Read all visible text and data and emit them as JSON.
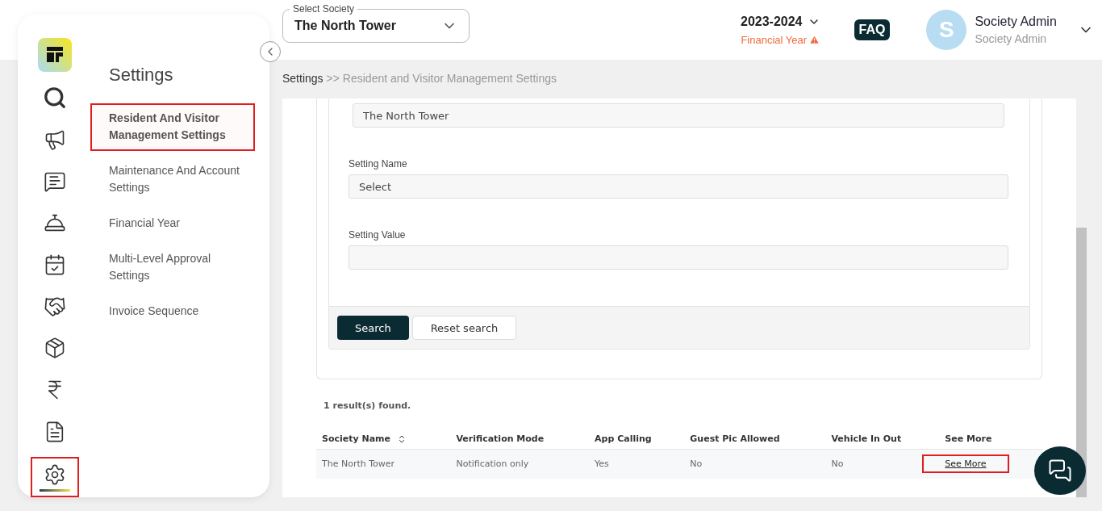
{
  "header": {
    "society_select": {
      "label": "Select Society",
      "value": "The North Tower"
    },
    "financial_year": {
      "value": "2023-2024",
      "label": "Financial Year",
      "warning": true
    },
    "faq": "FAQ",
    "user": {
      "initial": "S",
      "name": "Society Admin",
      "role": "Society Admin"
    }
  },
  "rail": [
    {
      "kind": "logo",
      "selected": false,
      "highlighted": false
    },
    {
      "kind": "search",
      "selected": false,
      "highlighted": false
    },
    {
      "kind": "megaphone",
      "selected": false,
      "highlighted": false
    },
    {
      "kind": "chat",
      "selected": false,
      "highlighted": false
    },
    {
      "kind": "desk",
      "selected": false,
      "highlighted": false
    },
    {
      "kind": "calendar",
      "selected": false,
      "highlighted": false
    },
    {
      "kind": "handshake",
      "selected": false,
      "highlighted": false
    },
    {
      "kind": "box",
      "selected": false,
      "highlighted": false
    },
    {
      "kind": "rupee",
      "selected": false,
      "highlighted": false
    },
    {
      "kind": "report",
      "selected": false,
      "highlighted": false
    },
    {
      "kind": "settings",
      "selected": true,
      "highlighted": true
    }
  ],
  "menu": {
    "title": "Settings",
    "items": [
      {
        "label": "Resident And Visitor Management Settings",
        "selected": true,
        "highlighted": true
      },
      {
        "label": "Maintenance And Account Settings",
        "selected": false,
        "highlighted": false
      },
      {
        "label": "Financial Year",
        "selected": false,
        "highlighted": false
      },
      {
        "label": "Multi-Level Approval Settings",
        "selected": false,
        "highlighted": false
      },
      {
        "label": "Invoice Sequence",
        "selected": false,
        "highlighted": false
      }
    ]
  },
  "breadcrumb": {
    "root": "Settings",
    "separator": ">>",
    "current": "Resident and Visitor Management Settings"
  },
  "form": {
    "fields": [
      {
        "value": "The North Tower"
      },
      {
        "label": "Setting Name",
        "value": "Select"
      },
      {
        "label": "Setting Value"
      }
    ],
    "buttons": [
      {
        "label": "Search",
        "kind": "primary"
      },
      {
        "label": "Reset search",
        "kind": "secondary"
      }
    ]
  },
  "results": {
    "summary": "1 result(s) found."
  },
  "table": {
    "columns": [
      {
        "label": "Society Name",
        "sortable": true
      },
      {
        "label": "Verification Mode",
        "sortable": false
      },
      {
        "label": "App Calling",
        "sortable": false
      },
      {
        "label": "Guest Pic Allowed",
        "sortable": false
      },
      {
        "label": "Vehicle In Out",
        "sortable": false
      },
      {
        "label": "See More",
        "sortable": false
      }
    ],
    "rows": [
      {
        "cells": [
          "The North Tower",
          "Notification only",
          "Yes",
          "No",
          "No"
        ],
        "link": {
          "label": "See More",
          "highlighted": true
        }
      }
    ]
  }
}
